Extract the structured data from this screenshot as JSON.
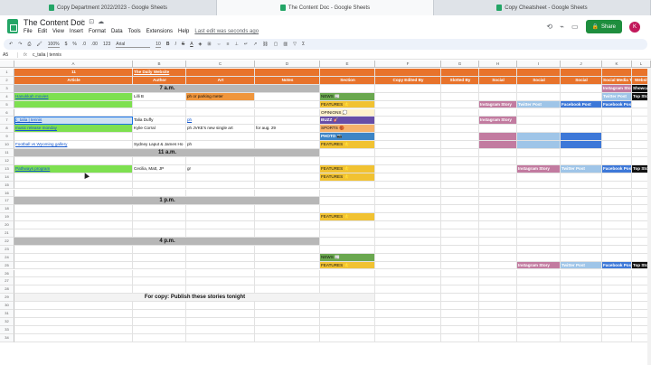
{
  "browser_tabs": [
    {
      "label": "Copy Department 2022/2023 - Google Sheets",
      "active": false
    },
    {
      "label": "The Content Doc - Google Sheets",
      "active": true
    },
    {
      "label": "Copy Cheatsheet - Google Sheets",
      "active": false
    }
  ],
  "doc": {
    "title": "The Content Doc",
    "title_icons": [
      "☆",
      "⊡",
      "☁"
    ],
    "last_edit": "Last edit was seconds ago",
    "share": "Share",
    "avatar": "K"
  },
  "menu": [
    "File",
    "Edit",
    "View",
    "Insert",
    "Format",
    "Data",
    "Tools",
    "Extensions",
    "Help"
  ],
  "toolbar": {
    "zoom": "100%",
    "currency": "$",
    "percent": "%",
    "dec0": ".0",
    "dec00": ".00",
    "numfmt": "123",
    "font": "Arial",
    "size": "10",
    "bold": "B",
    "italic": "I",
    "strike": "S",
    "color": "A"
  },
  "formula": {
    "ref": "A5",
    "fx": "fx",
    "value": "c_talia | tennis"
  },
  "columns": [
    {
      "label": "A"
    },
    {
      "label": "B"
    },
    {
      "label": "C"
    },
    {
      "label": "D"
    },
    {
      "label": "E"
    },
    {
      "label": "F"
    },
    {
      "label": "G"
    },
    {
      "label": "H"
    },
    {
      "label": "I"
    },
    {
      "label": "J"
    },
    {
      "label": "K"
    },
    {
      "label": "L"
    }
  ],
  "rows": [
    "1",
    "2",
    "3",
    "4",
    "5",
    "6",
    "7",
    "8",
    "9",
    "10",
    "11",
    "12",
    "13",
    "14",
    "15",
    "16",
    "17",
    "18",
    "19",
    "20",
    "21",
    "22",
    "23",
    "24",
    "25",
    "26",
    "27",
    "28",
    "29",
    "30",
    "31",
    "32",
    "33",
    "34"
  ],
  "header_row1": {
    "a": "11",
    "b": "The Daily Website"
  },
  "header_row2": [
    "Article",
    "Author",
    "Art",
    "Notes",
    "Section",
    "Copy Edited By",
    "Slotted By",
    "Social",
    "Social",
    "Social",
    "Social Media Ter",
    "Websit"
  ],
  "times": [
    "7 a.m.",
    "11 a.m.",
    "1 p.m.",
    "4 p.m."
  ],
  "cells": [
    {
      "r": 3,
      "c": 0,
      "t": "Hanukkah movies",
      "link": true,
      "bg": "#7ee050"
    },
    {
      "r": 3,
      "c": 1,
      "t": "Lilli B"
    },
    {
      "r": 3,
      "c": 2,
      "t": "ph or parking meter",
      "bg": "#f0963c"
    },
    {
      "r": 4,
      "c": 0,
      "t": "",
      "bg": "#7ee050"
    },
    {
      "r": 6,
      "c": 0,
      "t": "c_talia | tennis",
      "link": true,
      "bg": "#cfe2f3"
    },
    {
      "r": 6,
      "c": 1,
      "t": "Talia Duffy"
    },
    {
      "r": 6,
      "c": 2,
      "t": "ph",
      "link": true
    },
    {
      "r": 7,
      "c": 0,
      "t": "music release monday",
      "link": true,
      "bg": "#7ee050"
    },
    {
      "r": 7,
      "c": 1,
      "t": "Kylie Corral"
    },
    {
      "r": 7,
      "c": 2,
      "t": "ph JVKE's new single art"
    },
    {
      "r": 7,
      "c": 3,
      "t": "for aug. 29"
    },
    {
      "r": 9,
      "c": 0,
      "t": "Football vs Wyoming gallery",
      "link": true
    },
    {
      "r": 9,
      "c": 1,
      "t": "Sydney Laput & James Ho"
    },
    {
      "r": 9,
      "c": 2,
      "t": "ph"
    },
    {
      "r": 12,
      "c": 0,
      "t": "Pathways program",
      "link": true,
      "bg": "#7ee050"
    },
    {
      "r": 12,
      "c": 1,
      "t": "Cecilia, Matt, JP"
    },
    {
      "r": 12,
      "c": 2,
      "t": "gr"
    },
    {
      "r": 3,
      "c": 4,
      "t": "NEWS 📰",
      "bg": "#6aa84f"
    },
    {
      "r": 4,
      "c": 4,
      "t": "FEATURES ⭐",
      "bg": "#f1c232"
    },
    {
      "r": 5,
      "c": 4,
      "t": "OPINIONS 💭",
      "bg": "#fff2cc"
    },
    {
      "r": 6,
      "c": 4,
      "t": "BUZZ 🎸",
      "bg": "#674ea7",
      "fg": "#fff"
    },
    {
      "r": 7,
      "c": 4,
      "t": "SPORTS 🏀",
      "bg": "#f6b26b"
    },
    {
      "r": 8,
      "c": 4,
      "t": "PHOTO 📷",
      "bg": "#3d85c6",
      "fg": "#fff"
    },
    {
      "r": 9,
      "c": 4,
      "t": "FEATURES ⭐",
      "bg": "#f1c232"
    },
    {
      "r": 12,
      "c": 4,
      "t": "FEATURES ⭐",
      "bg": "#f1c232"
    },
    {
      "r": 13,
      "c": 4,
      "t": "FEATURES ⭐",
      "bg": "#f1c232"
    },
    {
      "r": 18,
      "c": 4,
      "t": "FEATURES ⭐",
      "bg": "#f1c232"
    },
    {
      "r": 23,
      "c": 4,
      "t": "NEWS 📰",
      "bg": "#6aa84f"
    },
    {
      "r": 24,
      "c": 4,
      "t": "FEATURES ⭐",
      "bg": "#f1c232"
    },
    {
      "r": 2,
      "c": 10,
      "t": "Instagram Story",
      "bg": "#c27ba0",
      "fg": "#fff"
    },
    {
      "r": 2,
      "c": 11,
      "t": "Showcase",
      "bg": "#111",
      "fg": "#fff"
    },
    {
      "r": 3,
      "c": 10,
      "t": "Twitter Post",
      "bg": "#9fc5e8",
      "fg": "#fff"
    },
    {
      "r": 3,
      "c": 11,
      "t": "Top Story",
      "bg": "#111",
      "fg": "#fff"
    },
    {
      "r": 4,
      "c": 7,
      "t": "Instagram Story",
      "bg": "#c27ba0",
      "fg": "#fff"
    },
    {
      "r": 4,
      "c": 8,
      "t": "Twitter Post",
      "bg": "#9fc5e8",
      "fg": "#fff"
    },
    {
      "r": 4,
      "c": 9,
      "t": "Facebook Post",
      "bg": "#3d78d8",
      "fg": "#fff"
    },
    {
      "r": 4,
      "c": 10,
      "t": "Facebook Post",
      "bg": "#3d78d8",
      "fg": "#fff"
    },
    {
      "r": 6,
      "c": 7,
      "t": "Instagram Story",
      "bg": "#c27ba0",
      "fg": "#fff"
    },
    {
      "r": 8,
      "c": 7,
      "t": "",
      "bg": "#c27ba0"
    },
    {
      "r": 9,
      "c": 7,
      "t": "",
      "bg": "#c27ba0"
    },
    {
      "r": 8,
      "c": 8,
      "t": "",
      "bg": "#9fc5e8"
    },
    {
      "r": 9,
      "c": 8,
      "t": "",
      "bg": "#9fc5e8"
    },
    {
      "r": 8,
      "c": 9,
      "t": "",
      "bg": "#3d78d8"
    },
    {
      "r": 9,
      "c": 9,
      "t": "",
      "bg": "#3d78d8"
    },
    {
      "r": 12,
      "c": 8,
      "t": "Instagram Story",
      "bg": "#c27ba0",
      "fg": "#fff"
    },
    {
      "r": 12,
      "c": 9,
      "t": "Twitter Post",
      "bg": "#9fc5e8",
      "fg": "#fff"
    },
    {
      "r": 12,
      "c": 10,
      "t": "Facebook Post",
      "bg": "#3d78d8",
      "fg": "#fff"
    },
    {
      "r": 12,
      "c": 11,
      "t": "Top Story",
      "bg": "#111",
      "fg": "#fff"
    },
    {
      "r": 24,
      "c": 8,
      "t": "Instagram Story",
      "bg": "#c27ba0",
      "fg": "#fff"
    },
    {
      "r": 24,
      "c": 9,
      "t": "Twitter Post",
      "bg": "#9fc5e8",
      "fg": "#fff"
    },
    {
      "r": 24,
      "c": 10,
      "t": "Facebook Post",
      "bg": "#3d78d8",
      "fg": "#fff"
    },
    {
      "r": 24,
      "c": 11,
      "t": "Top Story",
      "bg": "#111",
      "fg": "#fff"
    }
  ],
  "note": "For copy: Publish these stories tonight",
  "colors": {
    "header_orange": "#e8732b",
    "time_band": "#b7b7b7",
    "link": "#1155cc"
  }
}
